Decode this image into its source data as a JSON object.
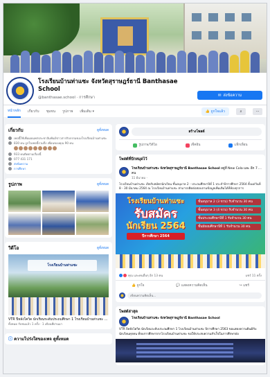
{
  "page": {
    "name_line1": "โรงเรียนบ้านท่าแซะ จังหวัดสุราษฎร์ธานี Banthasae",
    "name_line2": "School",
    "handle": "@banthasae.school · การศึกษา",
    "message_button": "ส่งข้อความ"
  },
  "tabs": [
    "หน้าหลัก",
    "เกี่ยวกับ",
    "ชุมชน",
    "รูปภาพ",
    "เพิ่มเติม ▾"
  ],
  "like_button": "ถูกใจแล้ว",
  "about": {
    "title": "เกี่ยวกับ",
    "see_all": "ดูทั้งหมด",
    "lines": [
      "เพจนี้ใช้เพื่อเผยแพร่ประชาสัมพันธ์ข่าวสารกิจกรรมของโรงเรียนบ้านท่าแซะ",
      "830 คน ถูกใจเพจนี้รวมถึง เพื่อนของคุณ 90 คน",
      "933 คนติดตามเรื่องนี้",
      "077 431 171",
      "ส่งข้อความ",
      "การศึกษา"
    ]
  },
  "photos": {
    "title": "รูปภาพ",
    "see_all": "ดูทั้งหมด"
  },
  "videos": {
    "title": "วิดีโอ",
    "see_all": "ดูทั้งหมด",
    "thumb_title": "โรงเรียนบ้านท่าแซะ",
    "caption": "VTR ปีหลังโควิด นักเรียนระดับประถมศึกษา 1 โรงเรียนบ้านท่าแซะ ...",
    "meta": "ทั้งหมด รับชมแล้ว 1 ครั้ง · 1 เดือนที่ผ่านมา"
  },
  "transparency": {
    "title": "ความโปร่งใสของเพจ",
    "see_all": "ดูทั้งหมด"
  },
  "create_post": {
    "label": "สร้างโพสต์",
    "actions": [
      "รูปภาพ/วิดีโอ",
      "เช็คอิน",
      "แท็กเพื่อน"
    ]
  },
  "pinned_section": "โพสต์ที่ปักหมุดไว้",
  "post": {
    "author": "โรงเรียนบ้านท่าแซะ จังหวัดสุราษฎร์ธานี Banthasae School",
    "extra": "อยู่ที่ New Cola และ อีก 7 คน",
    "time": "11 มีนาคม ·",
    "body": "โรงเรียนบ้านท่าแซะ เปิดรับสมัครนักเรียน ชั้นอนุบาล 2 - ประถมศึกษาปีที่ 1 ประจำปีการศึกษา 2564 ตั้งแต่วันที่ 8 - 30 มีนาคม 2564 ณ โรงเรียนบ้านท่าแซะ สามารถติดต่อสอบถามข้อมูลเพิ่มเติมได้ที่ห้องธุรการ"
  },
  "poster": {
    "line1": "โรงเรียนบ้านท่าแซะ",
    "line2": "รับสมัคร",
    "line3": "นักเรียน 2564",
    "tag": "ปีการศึกษา 2564",
    "details": [
      "ชั้นอนุบาล 2 (3 ขวบ) รับจำนวน 30 คน",
      "ชั้นอนุบาล 3 (4 ขวบ) รับจำนวน 30 คน",
      "ชั้นประถมศึกษาปีที่ 1 รับจำนวน 30 คน",
      "ชั้นมัธยมศึกษาปีที่ 1 รับจำนวน 30 คน"
    ]
  },
  "reactions": {
    "left": "คุณ และคนอื่นๆ อีก 13 คน",
    "right": "แชร์ 11 ครั้ง"
  },
  "post_actions": [
    "ถูกใจ",
    "แสดงความคิดเห็น",
    "แชร์"
  ],
  "comment_placeholder": "เขียนความคิดเห็น...",
  "recent_section": "โพสต์ล่าสุด",
  "post2": {
    "author": "โรงเรียนบ้านท่าแซะ จังหวัดสุราษฎร์ธานี Banthasae School",
    "body": "VTR ปีหลังโควิด นักเรียนระดับประถมศึกษา 1 โรงเรียนบ้านท่าแซะ ปีการศึกษา 2563 ขอแสดงความยินดีกับนักเรียนทุกคน ที่จบการศึกษาจากโรงเรียนบ้านท่าแซะ ขอให้ประสบความสำเร็จในการศึกษาต่อ"
  }
}
